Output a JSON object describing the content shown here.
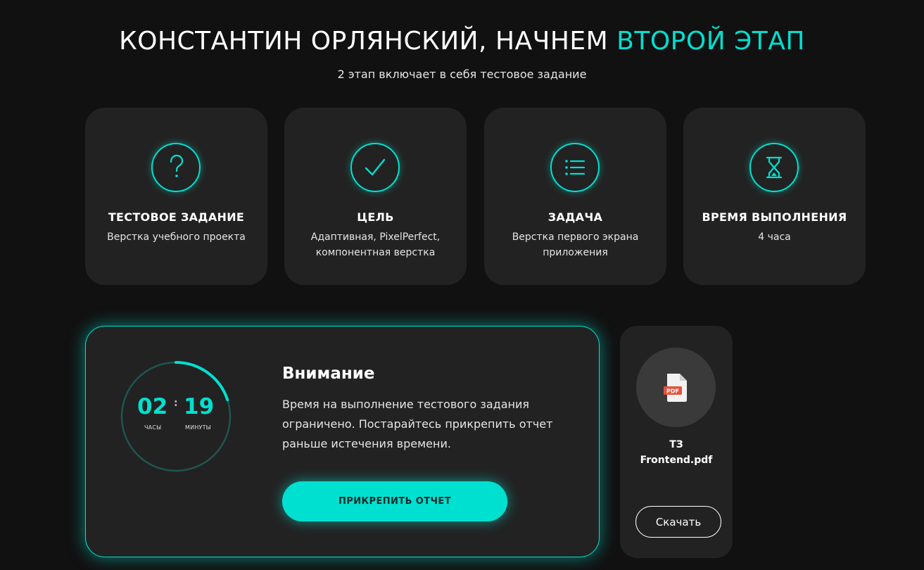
{
  "header": {
    "title_main": "КОНСТАНТИН ОРЛЯНСКИЙ, НАЧНЕМ",
    "title_accent": "ВТОРОЙ ЭТАП",
    "subtitle": "2 этап включает в себя тестовое задание"
  },
  "cards": [
    {
      "icon": "question-icon",
      "title": "ТЕСТОВОЕ ЗАДАНИЕ",
      "text": "Верстка учебного проекта"
    },
    {
      "icon": "checkmark-icon",
      "title": "ЦЕЛЬ",
      "text": "Адаптивная, PixelPerfect, компонентная верстка"
    },
    {
      "icon": "list-icon",
      "title": "ЗАДАЧА",
      "text": "Верстка первого экрана приложения"
    },
    {
      "icon": "hourglass-icon",
      "title": "ВРЕМЯ ВЫПОЛНЕНИЯ",
      "text": "4 часа"
    }
  ],
  "attention": {
    "title": "Внимание",
    "text": "Время на выполнение тестового задания ограничено. Постарайтесь прикрепить отчет раньше истечения времени.",
    "button_label": "ПРИКРЕПИТЬ ОТЧЕТ"
  },
  "timer": {
    "hours": "02",
    "separator": ":",
    "minutes": "19",
    "hours_label": "ЧАСЫ",
    "minutes_label": "МИНУТЫ",
    "elapsed_fraction": 0.2
  },
  "file": {
    "icon": "pdf-file-icon",
    "badge": "PDF",
    "name_line1": "ТЗ",
    "name_line2": "Frontend.pdf",
    "download_label": "Скачать"
  },
  "colors": {
    "accent": "#00e0d0",
    "background": "#111111",
    "card": "#222222",
    "pdf_badge": "#e5533d"
  }
}
